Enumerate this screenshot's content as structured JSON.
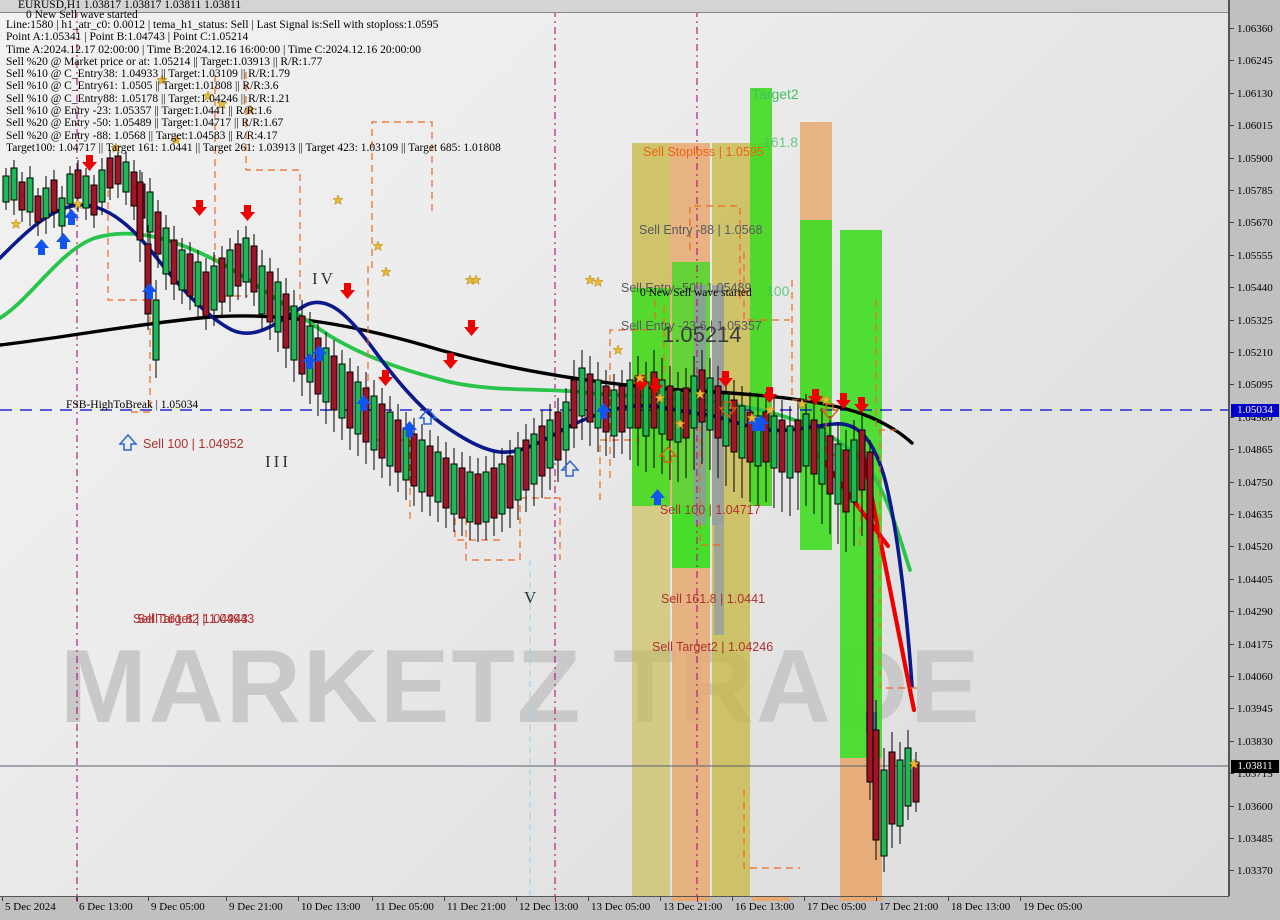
{
  "window": {
    "symbol_title": "EURUSD,H1  1.03817 1.03817 1.03811 1.03811"
  },
  "info_panel": {
    "wave_banner": "0 New Sell wave started",
    "lines": [
      "Line:1580  |  h1_atr_c0: 0.0012  |  tema_h1_status: Sell  |  Last Signal is:Sell with stoploss:1.0595",
      "Point A:1.05341  |  Point B:1.04743  |  Point C:1.05214",
      "Time A:2024.12.17 02:00:00  |  Time B:2024.12.16 16:00:00  |  Time C:2024.12.16 20:00:00",
      "Sell %20 @ Market price or at: 1.05214 ||  Target:1.03913 ||  R/R:1.77",
      "Sell %10 @ C_Entry38: 1.04933 ||  Target:1.03109 ||  R/R:1.79",
      "Sell %10 @ C_Entry61: 1.0505 ||  Target:1.01808 ||  R/R:3.6",
      "Sell %10 @ C_Entry88: 1.05178 ||  Target:1.04246 ||  R/R:1.21",
      "Sell %10 @ Entry -23: 1.05357 ||  Target:1.0441 ||  R/R:1.6",
      "Sell %20 @ Entry -50: 1.05489 ||  Target:1.04717 ||  R/R:1.67",
      "Sell %20 @ Entry -88: 1.0568 ||  Target:1.04583 ||  R/R:4.17",
      "Target100: 1.04717 ||  Target 161: 1.0441 ||  Target 261: 1.03913 ||  Target 423: 1.03109 ||  Target 685: 1.01808"
    ]
  },
  "watermark": "MARKETZ TRADE",
  "price_axis": {
    "ticks": [
      "1.06360",
      "1.06245",
      "1.06130",
      "1.06015",
      "1.05900",
      "1.05785",
      "1.05670",
      "1.05555",
      "1.05440",
      "1.05325",
      "1.05210",
      "1.05095",
      "1.04980",
      "1.04865",
      "1.04750",
      "1.04635",
      "1.04520",
      "1.04405",
      "1.04290",
      "1.04175",
      "1.04060",
      "1.03945",
      "1.03830",
      "1.03715",
      "1.03600",
      "1.03485",
      "1.03370"
    ],
    "highlight_bid": "1.05034",
    "highlight_last": "1.03811"
  },
  "time_axis": {
    "ticks": [
      "5 Dec 2024",
      "6 Dec 13:00",
      "9 Dec 05:00",
      "9 Dec 21:00",
      "10 Dec 13:00",
      "11 Dec 05:00",
      "11 Dec 21:00",
      "12 Dec 13:00",
      "13 Dec 05:00",
      "13 Dec 21:00",
      "16 Dec 13:00",
      "17 Dec 05:00",
      "17 Dec 21:00",
      "18 Dec 13:00",
      "19 Dec 05:00"
    ]
  },
  "chart_labels": {
    "fsb_high_to_break": "FSB-HighToBreak  |  1.05034",
    "sell_100_left": "Sell 100 | 1.04952",
    "sell_target2_left": "Sell Target2 | 1.04943",
    "sell_1618_left": "Sell 161.8 | 1.04943",
    "sell_stoploss": "Sell Stoploss | 1.0595",
    "sell_entry_88": "Sell Entry -88 | 1.0568",
    "sell_entry_50": "Sell Entry -50 | 1.05489",
    "sell_entry_23": "Sell Entry -23.6 | 1.05357",
    "wave_mid": "0 New Sell wave started",
    "price_mid": "1.05214",
    "sell_100_mid": "Sell 100 | 1.04717",
    "sell_1618_mid": "Sell 161.8 | 1.0441",
    "sell_target2_mid": "Sell Target2 | 1.04246",
    "target2_top": "Target2",
    "fib_1618": "161.8",
    "fib_100": "100",
    "roman_iv": "IV",
    "roman_iii": "III",
    "roman_v": "V"
  },
  "colors": {
    "zone_green": "#3fdd22",
    "zone_orange": "#e8a971",
    "zone_olive": "#c8b946",
    "ma_fast_blue": "#0a1a8c",
    "ma_mid_green": "#29c44a",
    "ma_slow_black": "#000000",
    "signal_red": "#ee0000",
    "bid_line_blue": "#0000cc",
    "vline_magenta": "#b0107a",
    "dashed_orange": "#ef6820",
    "star_gold": "#e8b830"
  },
  "chart_data": {
    "type": "candlestick",
    "title": "EURUSD,H1",
    "ohlc_header": [
      "1.03817",
      "1.03817",
      "1.03811",
      "1.03811"
    ],
    "y_range": [
      1.0337,
      1.0636
    ],
    "x_range": [
      "5 Dec 2024",
      "19 Dec 05:00"
    ],
    "current_bid": 1.05034,
    "current_last": 1.03811,
    "levels": [
      {
        "name": "Sell Stoploss",
        "value": 1.0595
      },
      {
        "name": "Sell Entry -88",
        "value": 1.0568
      },
      {
        "name": "Sell Entry -50",
        "value": 1.05489
      },
      {
        "name": "Sell Entry -23.6",
        "value": 1.05357
      },
      {
        "name": "Point C / Market",
        "value": 1.05214
      },
      {
        "name": "FSB-HighToBreak",
        "value": 1.05034
      },
      {
        "name": "Sell 100 (left)",
        "value": 1.04952
      },
      {
        "name": "Sell Target2 (left)",
        "value": 1.04943
      },
      {
        "name": "Sell 100",
        "value": 1.04717
      },
      {
        "name": "Sell 161.8",
        "value": 1.0441
      },
      {
        "name": "Sell Target2",
        "value": 1.04246
      },
      {
        "name": "Target 261",
        "value": 1.03913
      },
      {
        "name": "Target 423",
        "value": 1.03109
      },
      {
        "name": "Target 685",
        "value": 1.01808
      }
    ],
    "fib_markers": [
      "Target2",
      "161.8",
      "100"
    ],
    "wave_labels": [
      "III",
      "IV",
      "V"
    ],
    "indicators": [
      {
        "name": "TEMA fast",
        "color": "#0a1a8c",
        "style": "line"
      },
      {
        "name": "TEMA mid",
        "color": "#29c44a",
        "style": "line"
      },
      {
        "name": "TEMA slow",
        "color": "#000000",
        "style": "line"
      },
      {
        "name": "Fractal channel",
        "color": "#ef6820",
        "style": "dashed"
      },
      {
        "name": "Signal projection",
        "color": "#ee0000",
        "style": "thick-line"
      }
    ]
  }
}
